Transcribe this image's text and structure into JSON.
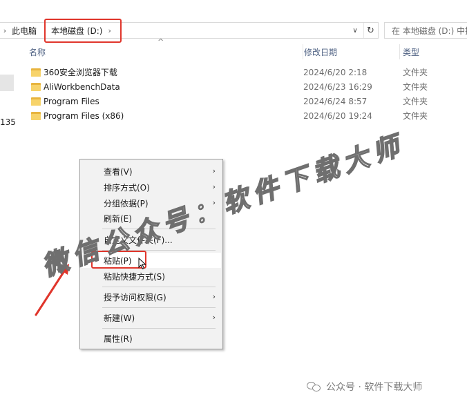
{
  "breadcrumb": {
    "items": [
      "此电脑",
      "本地磁盘 (D:)"
    ]
  },
  "search": {
    "text": "在 本地磁盘 (D:) 中搜"
  },
  "nav": {
    "number": "135"
  },
  "columns": {
    "name": "名称",
    "date": "修改日期",
    "type": "类型"
  },
  "files": [
    {
      "name": "360安全浏览器下载",
      "date": "2024/6/20 2:18",
      "type": "文件夹"
    },
    {
      "name": "AliWorkbenchData",
      "date": "2024/6/23 16:29",
      "type": "文件夹"
    },
    {
      "name": "Program Files",
      "date": "2024/6/24 8:57",
      "type": "文件夹"
    },
    {
      "name": "Program Files (x86)",
      "date": "2024/6/20 19:24",
      "type": "文件夹"
    }
  ],
  "context_menu": {
    "view": "查看(V)",
    "sort": "排序方式(O)",
    "group": "分组依据(P)",
    "refresh": "刷新(E)",
    "customize": "自定义文件夹(F)...",
    "paste": "粘贴(P)",
    "paste_shortcut": "粘贴快捷方式(S)",
    "give_access": "授予访问权限(G)",
    "new": "新建(W)",
    "properties": "属性(R)"
  },
  "watermark": {
    "text": "微信公众号：软件下载大师"
  },
  "credit": {
    "text": "公众号 · 软件下载大师"
  },
  "colors": {
    "highlight_red": "#e0352b",
    "folder_yellow": "#f7d36a",
    "header_text": "#4d6082"
  }
}
